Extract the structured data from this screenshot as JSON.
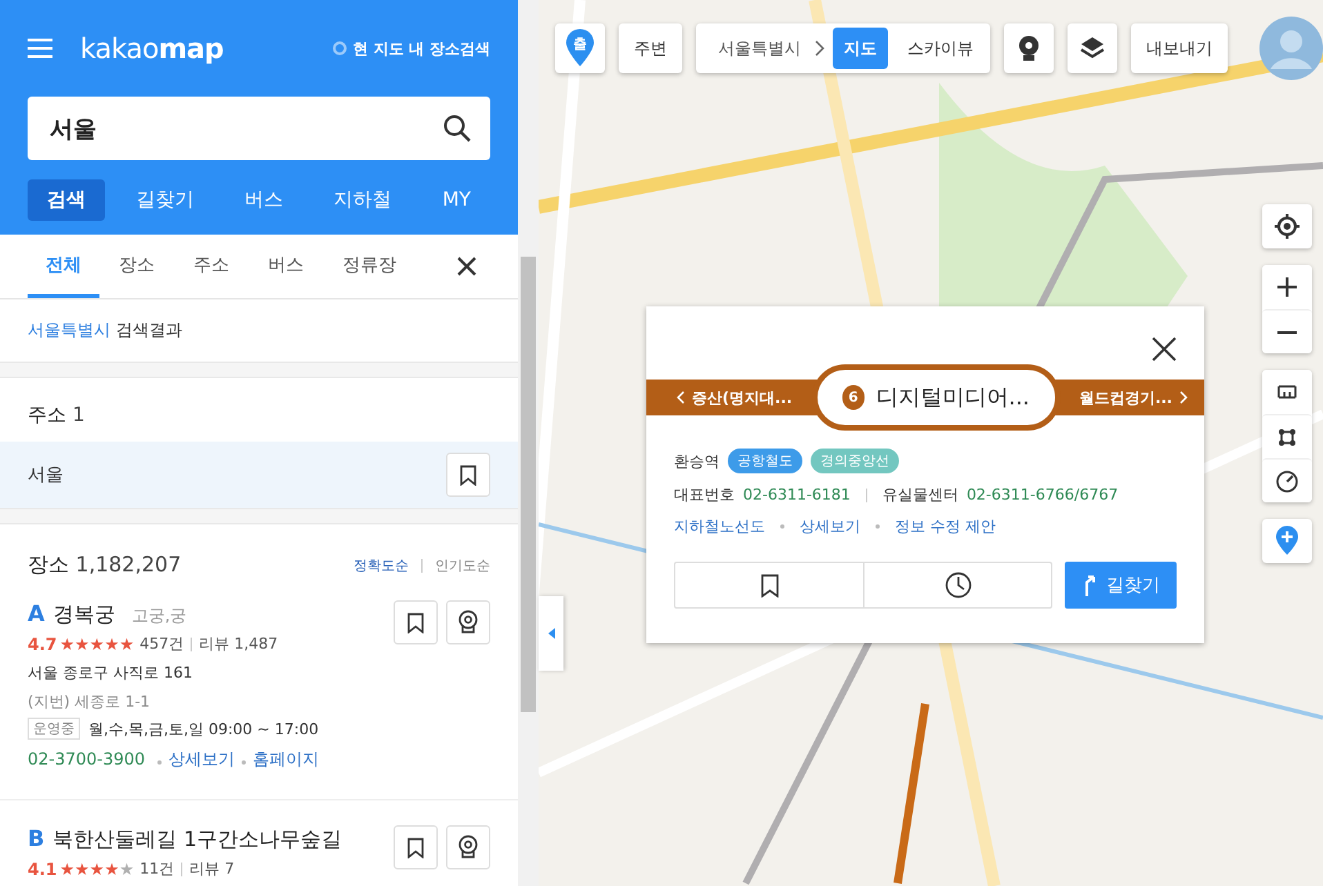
{
  "header": {
    "logo": "kakao**map**",
    "local_search": {
      "label": "현 지도 내 장소검색",
      "checked": false
    }
  },
  "search": {
    "value": "서울"
  },
  "nav_tabs": [
    {
      "label": "검색",
      "selected": true
    },
    {
      "label": "길찾기",
      "selected": false
    },
    {
      "label": "버스",
      "selected": false
    },
    {
      "label": "지하철",
      "selected": false
    },
    {
      "label": "MY",
      "selected": false
    }
  ],
  "filter_tabs": [
    {
      "label": "전체",
      "selected": true
    },
    {
      "label": "장소",
      "selected": false
    },
    {
      "label": "주소",
      "selected": false
    },
    {
      "label": "버스",
      "selected": false
    },
    {
      "label": "정류장",
      "selected": false
    }
  ],
  "result_caption": {
    "region": "서울특별시",
    "text": "검색결과"
  },
  "address_section": {
    "title": "주소",
    "count": "1",
    "items": [
      {
        "name": "서울",
        "selected": true
      }
    ]
  },
  "place_section": {
    "title": "장소",
    "count": "1,182,207",
    "sort_options": [
      {
        "label": "정확도순",
        "selected": true
      },
      {
        "label": "인기도순",
        "selected": false
      }
    ],
    "places": [
      {
        "marker": "A",
        "name": "경복궁",
        "category": "고궁,궁",
        "rating": "4.7",
        "stars": 5,
        "rating_count": "457건",
        "reviews": "리뷰 1,487",
        "address": "서울 종로구 사직로 161",
        "lot_address": "(지번) 세종로 1-1",
        "status": "운영중",
        "hours": "월,수,목,금,토,일 09:00 ~ 17:00",
        "phone": "02-3700-3900",
        "links": [
          "상세보기",
          "홈페이지"
        ]
      },
      {
        "marker": "B",
        "name": "북한산둘레길 1구간소나무숲길",
        "rating": "4.1",
        "stars": 4,
        "rating_count": "11건",
        "reviews": "리뷰 7"
      }
    ]
  },
  "map_toolbar": {
    "start_pin_label": "출",
    "nearby": "주변",
    "region": "서울특별시",
    "view_modes": [
      {
        "label": "지도",
        "selected": true
      },
      {
        "label": "스카이뷰",
        "selected": false
      }
    ],
    "export": "내보내기"
  },
  "station_popup": {
    "prev": "증산(명지대...",
    "number": "6",
    "title": "디지털미디어...",
    "next": "월드컵경기...",
    "transfer_label": "환승역",
    "lines": [
      {
        "name": "공항철도",
        "color": "#3d9be9"
      },
      {
        "name": "경의중앙선",
        "color": "#73c7c0"
      }
    ],
    "phone_label": "대표번호",
    "phone": "02-6311-6181",
    "lost_label": "유실물센터",
    "lost_phone": "02-6311-6766/6767",
    "links": [
      "지하철노선도",
      "상세보기",
      "정보 수정 제안"
    ],
    "route_button": "길찾기"
  }
}
